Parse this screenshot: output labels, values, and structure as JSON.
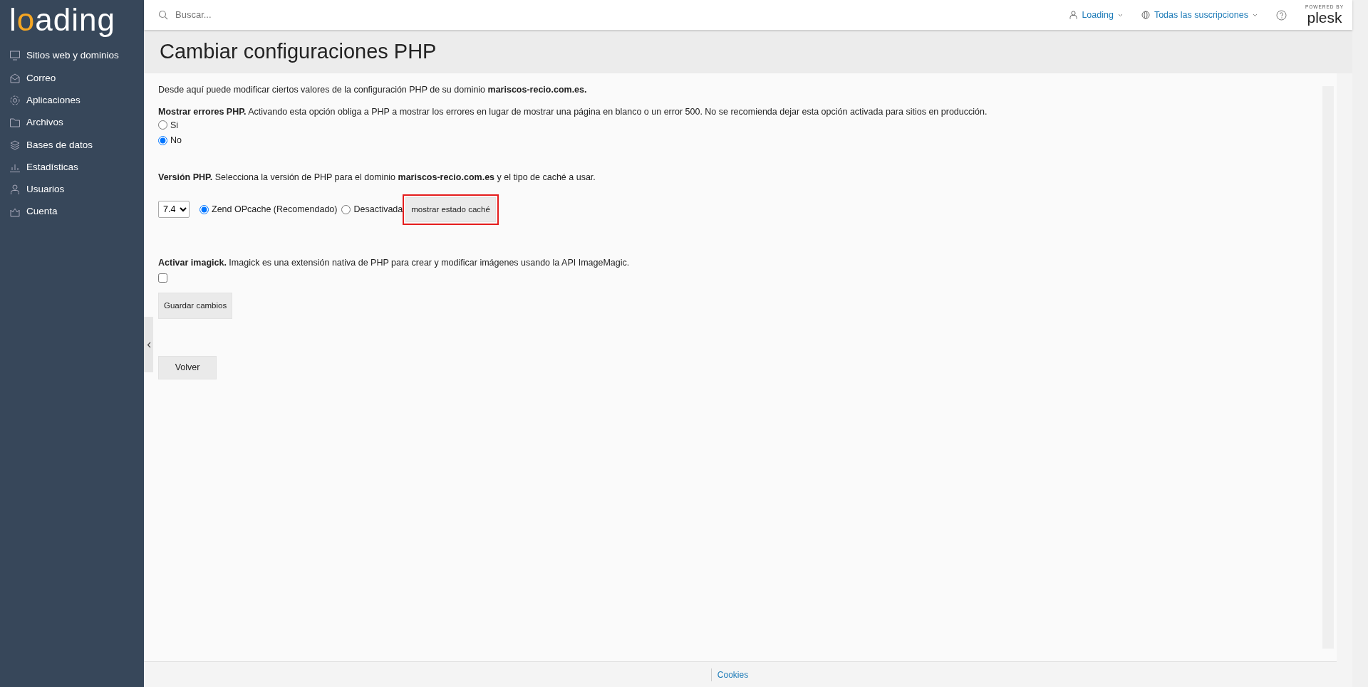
{
  "sidebar": {
    "logo": "loading",
    "items": [
      {
        "label": "Sitios web y dominios"
      },
      {
        "label": "Correo"
      },
      {
        "label": "Aplicaciones"
      },
      {
        "label": "Archivos"
      },
      {
        "label": "Bases de datos"
      },
      {
        "label": "Estadísticas"
      },
      {
        "label": "Usuarios"
      },
      {
        "label": "Cuenta"
      }
    ]
  },
  "header": {
    "search_placeholder": "Buscar...",
    "user": "Loading",
    "subscriptions": "Todas las suscripciones",
    "powered_by": "POWERED BY",
    "brand": "plesk"
  },
  "page_title": "Cambiar configuraciones PHP",
  "intro": "Desde aquí puede modificar ciertos valores de la configuración PHP de su dominio **mariscos-recio.com.es.**",
  "php_errors": {
    "text": "**Mostrar errores PHP.** Activando esta opción obliga a PHP a mostrar los errores en lugar de mostrar una página en blanco o un error 500. No se recomienda dejar esta opción activada para sitios en producción.",
    "options": [
      {
        "label": "Si",
        "selected": false
      },
      {
        "label": "No",
        "selected": true
      }
    ]
  },
  "php_version": {
    "text": "**Versión PHP.** Selecciona la versión de PHP para el dominio **mariscos-recio.com.es** y el tipo de caché a usar.",
    "version": "7.4",
    "cache_options": [
      {
        "label": "Zend OPcache (Recomendado)",
        "selected": true
      },
      {
        "label": "Desactivada",
        "selected": false
      }
    ],
    "status_button": "mostrar estado caché"
  },
  "imagick": {
    "text": "**Activar imagick.** Imagick es una extensión nativa de PHP para crear y modificar imágenes usando la API ImageMagic.",
    "checked": false
  },
  "save_button": "Guardar cambios",
  "back_button": "Volver",
  "footer": {
    "link": "Cookies"
  }
}
